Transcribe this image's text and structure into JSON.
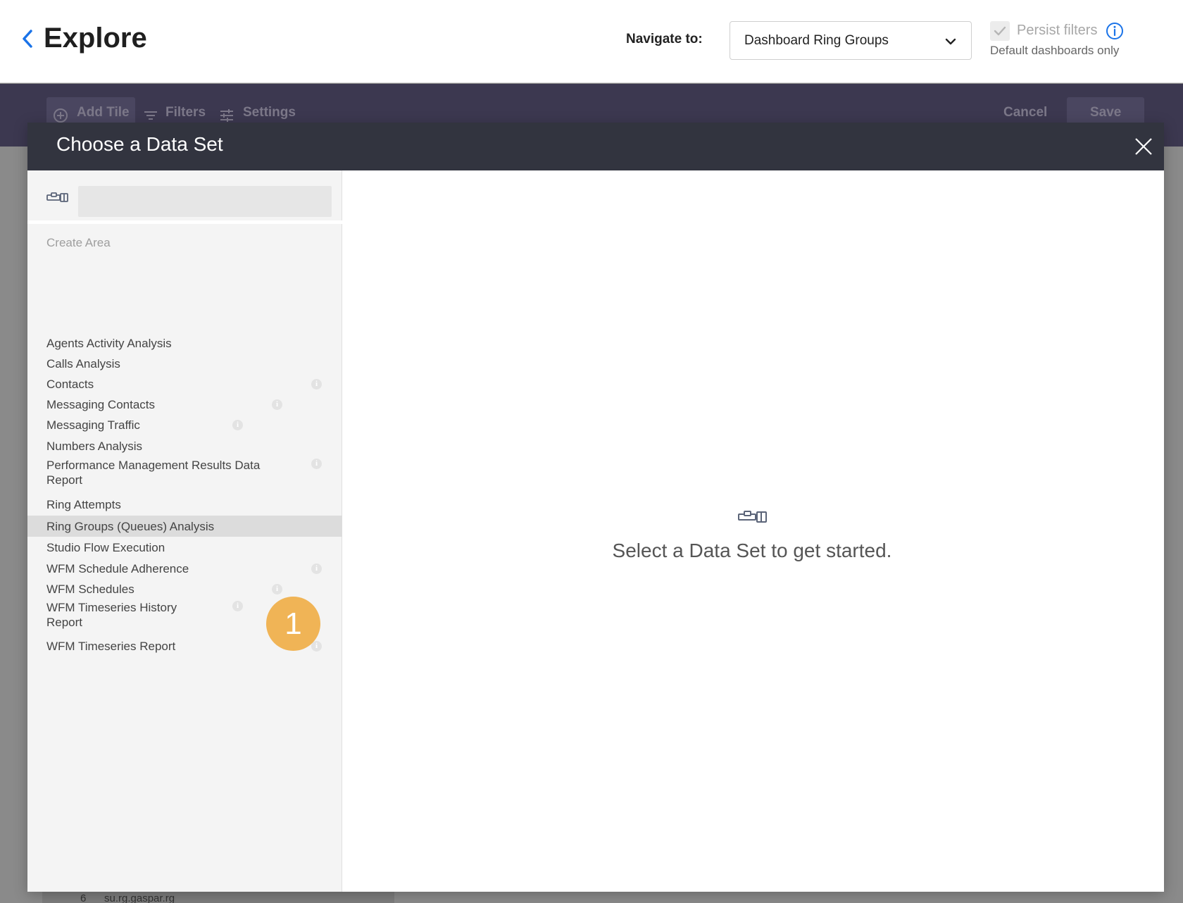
{
  "header": {
    "title": "Explore",
    "navigate_label": "Navigate to:",
    "navigate_value": "Dashboard Ring Groups",
    "persist_label": "Persist filters",
    "persist_sub": "Default dashboards only"
  },
  "toolbar": {
    "add_tile": "Add Tile",
    "filters": "Filters",
    "settings": "Settings",
    "cancel": "Cancel",
    "save": "Save"
  },
  "background_table": {
    "row_number": "6",
    "row_text": "su.rg.gaspar.rg"
  },
  "modal": {
    "title": "Choose a Data Set",
    "search_placeholder": "",
    "section_label": "Create Area",
    "items": [
      {
        "label": "Agents Activity Analysis",
        "info": false,
        "selected": false
      },
      {
        "label": "Calls Analysis",
        "info": false,
        "selected": false
      },
      {
        "label": "Contacts",
        "info": true,
        "selected": false
      },
      {
        "label": "Messaging Contacts",
        "info": true,
        "selected": false
      },
      {
        "label": "Messaging Traffic",
        "info": true,
        "selected": false
      },
      {
        "label": "Numbers Analysis",
        "info": false,
        "selected": false
      },
      {
        "label": "Performance Management Results Data Report",
        "info": true,
        "selected": false
      },
      {
        "label": "Ring Attempts",
        "info": false,
        "selected": false
      },
      {
        "label": "Ring Groups (Queues) Analysis",
        "info": false,
        "selected": true
      },
      {
        "label": "Studio Flow Execution",
        "info": false,
        "selected": false
      },
      {
        "label": "WFM Schedule Adherence",
        "info": true,
        "selected": false
      },
      {
        "label": "WFM Schedules",
        "info": true,
        "selected": false
      },
      {
        "label": "WFM Timeseries History Report",
        "info": true,
        "selected": false
      },
      {
        "label": "WFM Timeseries Report",
        "info": true,
        "selected": false
      }
    ],
    "step_badge": "1",
    "empty_text": "Select a Data Set to get started."
  },
  "colors": {
    "accent_blue": "#1a73e8",
    "header_dark": "#32343f",
    "toolbar_dark": "#3c3850",
    "step_badge": "#f0b456"
  }
}
